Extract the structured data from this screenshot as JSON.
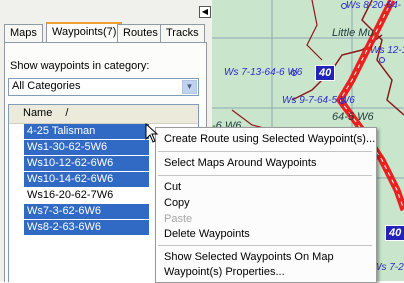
{
  "tabs": [
    {
      "label": "Maps",
      "active": false
    },
    {
      "label": "Waypoints(7)",
      "active": true
    },
    {
      "label": "Routes",
      "active": false
    },
    {
      "label": "Tracks",
      "active": false
    }
  ],
  "category": {
    "label": "Show waypoints in category:",
    "selected": "All Categories"
  },
  "list": {
    "header": "Name",
    "sort_indicator": "/",
    "rows": [
      {
        "name": "4-25 Talisman",
        "selected": true
      },
      {
        "name": "Ws1-30-62-5W6",
        "selected": true
      },
      {
        "name": "Ws10-12-62-6W6",
        "selected": true
      },
      {
        "name": "Ws10-14-62-6W6",
        "selected": true
      },
      {
        "name": "Ws16-20-62-7W6",
        "selected": false
      },
      {
        "name": "Ws7-3-62-6W6",
        "selected": true
      },
      {
        "name": "Ws8-2-63-6W6",
        "selected": true
      }
    ]
  },
  "context_menu": {
    "items": [
      {
        "label": "Create Route using Selected Waypoint(s)...",
        "enabled": true
      },
      {
        "label": "Select Maps Around Waypoints",
        "enabled": true
      },
      {
        "label": "Cut",
        "enabled": true
      },
      {
        "label": "Copy",
        "enabled": true
      },
      {
        "label": "Paste",
        "enabled": false
      },
      {
        "label": "Delete Waypoints",
        "enabled": true
      },
      {
        "label": "Show Selected Waypoints On Map",
        "enabled": true
      },
      {
        "label": "Waypoint(s) Properties...",
        "enabled": true
      }
    ]
  },
  "map": {
    "labels": [
      "Ws 8-20-64-",
      "Little Mu",
      "Ws 12-16-",
      "Ws 7-13-64-6 W6",
      "Ws 9-7-64-5 W6",
      "64-5 W6",
      "-6 W6",
      "Ws 7-2"
    ],
    "shields": [
      "40",
      "40"
    ]
  },
  "colors": {
    "selection": "#316ac5",
    "map_background": "#c9e6cd",
    "highway": "#e8221e",
    "shield": "#2323b5",
    "tab_highlight": "#f0a030"
  },
  "icons": [
    "collapse-arrow-icon",
    "dropdown-arrow-icon",
    "mouse-pointer-icon"
  ]
}
